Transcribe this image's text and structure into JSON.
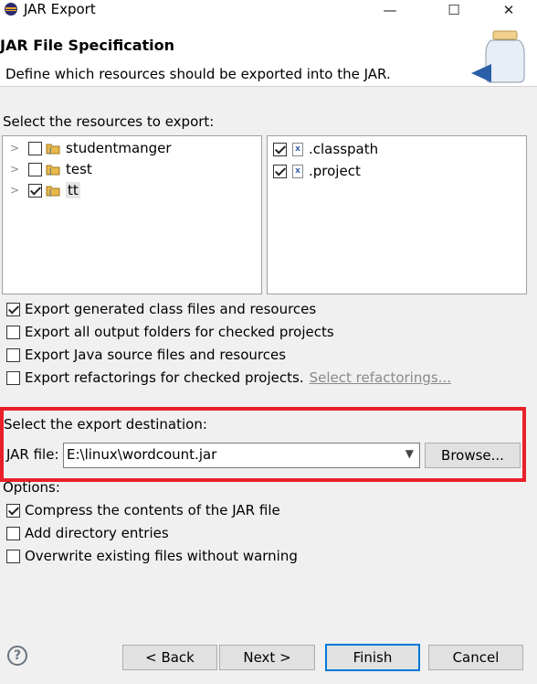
{
  "window": {
    "title": "JAR Export",
    "minimize_glyph": "—",
    "maximize_glyph": "☐",
    "close_glyph": "✕"
  },
  "header": {
    "title": "JAR File Specification",
    "description": "Define which resources should be exported into the JAR."
  },
  "resources": {
    "label": "Select the resources to export:",
    "projects": [
      {
        "name": "studentmanger",
        "checked": false
      },
      {
        "name": "test",
        "checked": false
      },
      {
        "name": "tt",
        "checked": true
      }
    ],
    "files": [
      {
        "name": ".classpath",
        "checked": true
      },
      {
        "name": ".project",
        "checked": true
      }
    ]
  },
  "export_options": [
    {
      "label": "Export generated class files and resources",
      "checked": true
    },
    {
      "label": "Export all output folders for checked projects",
      "checked": false
    },
    {
      "label": "Export Java source files and resources",
      "checked": false
    },
    {
      "label": "Export refactorings for checked projects.",
      "checked": false,
      "link": "Select refactorings..."
    }
  ],
  "destination": {
    "label": "Select the export destination:",
    "jar_label": "JAR file:",
    "jar_path": "E:\\linux\\wordcount.jar",
    "browse_label": "Browse...",
    "highlight_color": "#e8202a"
  },
  "options": {
    "label": "Options:",
    "items": [
      {
        "label": "Compress the contents of the JAR file",
        "checked": true
      },
      {
        "label": "Add directory entries",
        "checked": false
      },
      {
        "label": "Overwrite existing files without warning",
        "checked": false
      }
    ]
  },
  "footer": {
    "help_glyph": "?",
    "back_label": "< Back",
    "next_label": "Next >",
    "finish_label": "Finish",
    "cancel_label": "Cancel"
  },
  "icons": {
    "app": "eclipse-icon",
    "header": "jar-icon",
    "project": "java-project-icon",
    "file": "xml-file-icon",
    "help": "help-icon"
  }
}
